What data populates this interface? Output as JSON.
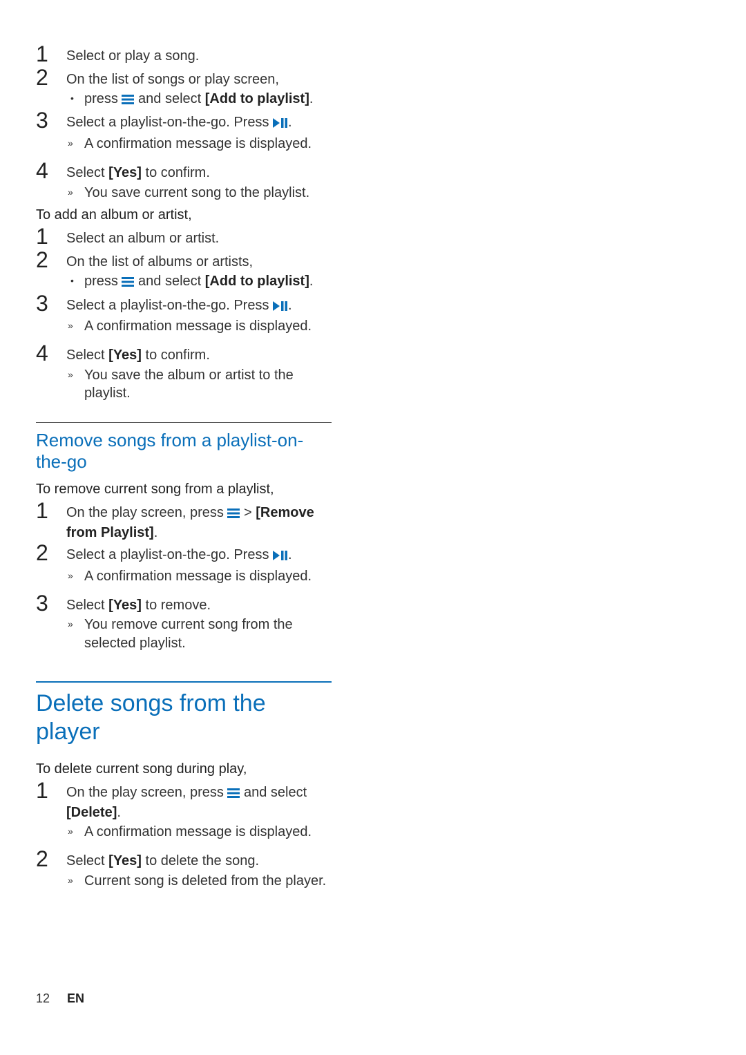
{
  "colors": {
    "accent": "#0a6fb9"
  },
  "icons": {
    "menu": "menu-icon",
    "playpause": "play-pause-icon"
  },
  "songSteps": {
    "s1": {
      "text": "Select or play a song."
    },
    "s2": {
      "text": "On the list of songs or play screen,",
      "bullet_pre": "press ",
      "bullet_mid": " and select ",
      "bullet_bold": "[Add to playlist]",
      "bullet_post": "."
    },
    "s3": {
      "pre": "Select a playlist-on-the-go. Press ",
      "post": ".",
      "result": "A confirmation message is displayed."
    },
    "s4": {
      "pre": "Select ",
      "bold": "[Yes]",
      "post": " to confirm.",
      "result": "You save current song to the playlist."
    }
  },
  "albumLead": "To add an album or artist,",
  "albumSteps": {
    "s1": {
      "text": "Select an album or artist."
    },
    "s2": {
      "text": "On the list of albums or artists,",
      "bullet_pre": "press ",
      "bullet_mid": " and select ",
      "bullet_bold": "[Add to playlist]",
      "bullet_post": "."
    },
    "s3": {
      "pre": "Select a playlist-on-the-go. Press ",
      "post": ".",
      "result": "A confirmation message is displayed."
    },
    "s4": {
      "pre": "Select ",
      "bold": "[Yes]",
      "post": " to confirm.",
      "result": "You save the album or artist to the playlist."
    }
  },
  "removeHeading": "Remove songs from a playlist-on-the-go",
  "removeLead": "To remove current song from a playlist,",
  "removeSteps": {
    "s1": {
      "pre": "On the play screen, press ",
      "mid": " > ",
      "bold": "[Remove from Playlist]",
      "post": "."
    },
    "s2": {
      "pre": "Select a playlist-on-the-go. Press ",
      "post": ".",
      "result": "A confirmation message is displayed."
    },
    "s3": {
      "pre": "Select ",
      "bold": "[Yes]",
      "post": " to remove.",
      "result": "You remove current song from the selected playlist."
    }
  },
  "deleteHeading": "Delete songs from the player",
  "deleteLead": "To delete current song during play,",
  "deleteSteps": {
    "s1": {
      "pre": "On the play screen, press ",
      "mid": " and select ",
      "bold": "[Delete]",
      "post": ".",
      "result": "A confirmation message is displayed."
    },
    "s2": {
      "pre": "Select ",
      "bold": "[Yes]",
      "post": " to delete the song.",
      "result": "Current song is deleted from the player."
    }
  },
  "nums": {
    "n1": "1",
    "n2": "2",
    "n3": "3",
    "n4": "4"
  },
  "marks": {
    "bullet": "•",
    "result": "»"
  },
  "footer": {
    "page": "12",
    "lang": "EN"
  }
}
